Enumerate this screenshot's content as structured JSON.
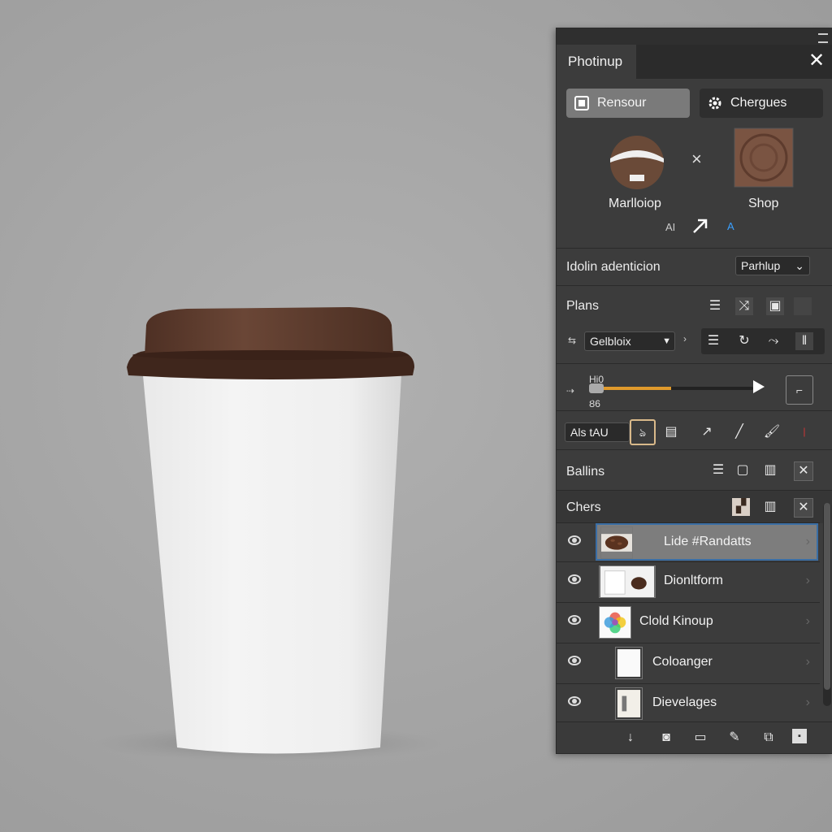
{
  "panel": {
    "tab_title": "Photinup",
    "buttons": {
      "resource": "Rensour",
      "changes": "Chergues"
    },
    "preview": {
      "left_label": "Marlloiop",
      "right_label": "Shop",
      "icons_left": "AI",
      "icons_right": "A"
    },
    "identification": {
      "label": "Idolin adenticion",
      "dropdown_value": "Parhlup"
    },
    "plans": {
      "title": "Plans",
      "dropdown_value": "Gelbloix"
    },
    "slider": {
      "top_label": "Hi0",
      "bottom_label": "Ȣ6",
      "value": 0.5
    },
    "tool_field": {
      "value": "Als tAU"
    },
    "ballins": {
      "title": "Ballins"
    },
    "chers": {
      "title": "Chers"
    },
    "layers": [
      {
        "name": "Lide #Randatts",
        "selected": true,
        "thumb": "coffee-beans"
      },
      {
        "name": "Dionltform",
        "selected": false,
        "thumb": "cup-photo"
      },
      {
        "name": "Clold Kinoup",
        "selected": false,
        "thumb": "color-wheel"
      },
      {
        "name": "Coloanger",
        "selected": false,
        "thumb": "white-doc"
      },
      {
        "name": "Dievelages",
        "selected": false,
        "thumb": "device-doc"
      }
    ]
  },
  "colors": {
    "panel_bg": "#3c3c3c",
    "accent_orange": "#e09a2c",
    "selection_blue": "#3a6ea5",
    "lid_brown": "#5a3a2c"
  }
}
